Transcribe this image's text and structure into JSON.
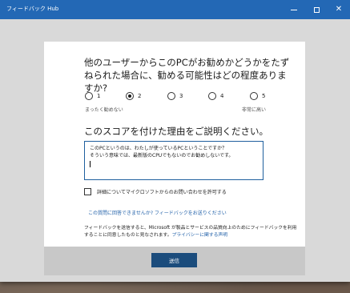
{
  "window": {
    "title": "フィードバック Hub",
    "controls": {
      "minimize": "—",
      "maximize": "□",
      "close": "✕"
    }
  },
  "survey": {
    "question": "他のユーザーからこのPCがお勧めかどうかをたずねられた場合に、勧める可能性はどの程度ありますか?",
    "rating": {
      "options": [
        "1",
        "2",
        "3",
        "4",
        "5"
      ],
      "selected": "2",
      "low_label": "まったく勧めない",
      "high_label": "非常に高い"
    },
    "reason_title": "このスコアを付けた理由をご説明ください。",
    "reason_text": [
      "このPCというのは、わたしが使っているPCということですか？",
      "そういう意味では、最新版のCPUでもないのでお勧めしないです。"
    ],
    "contact_checkbox_label": "詳細についてマイクロソフトからのお問い合わせを許可する",
    "contact_checked": false,
    "cant_answer_link": "この質問に回答できませんか? フィードバックをお送りください",
    "disclaimer_text": "フィードバックを送信すると、Microsoft が製品とサービスの品質向上のためにフィードバックを利用することに同意したものと見なされます。",
    "privacy_link": "プライバシーに関する声明",
    "send_label": "送信"
  },
  "colors": {
    "titlebar": "#2368b5",
    "accent_button": "#1b4c7c",
    "link": "#1f5fa8",
    "window_bg": "#d9d9d9"
  }
}
